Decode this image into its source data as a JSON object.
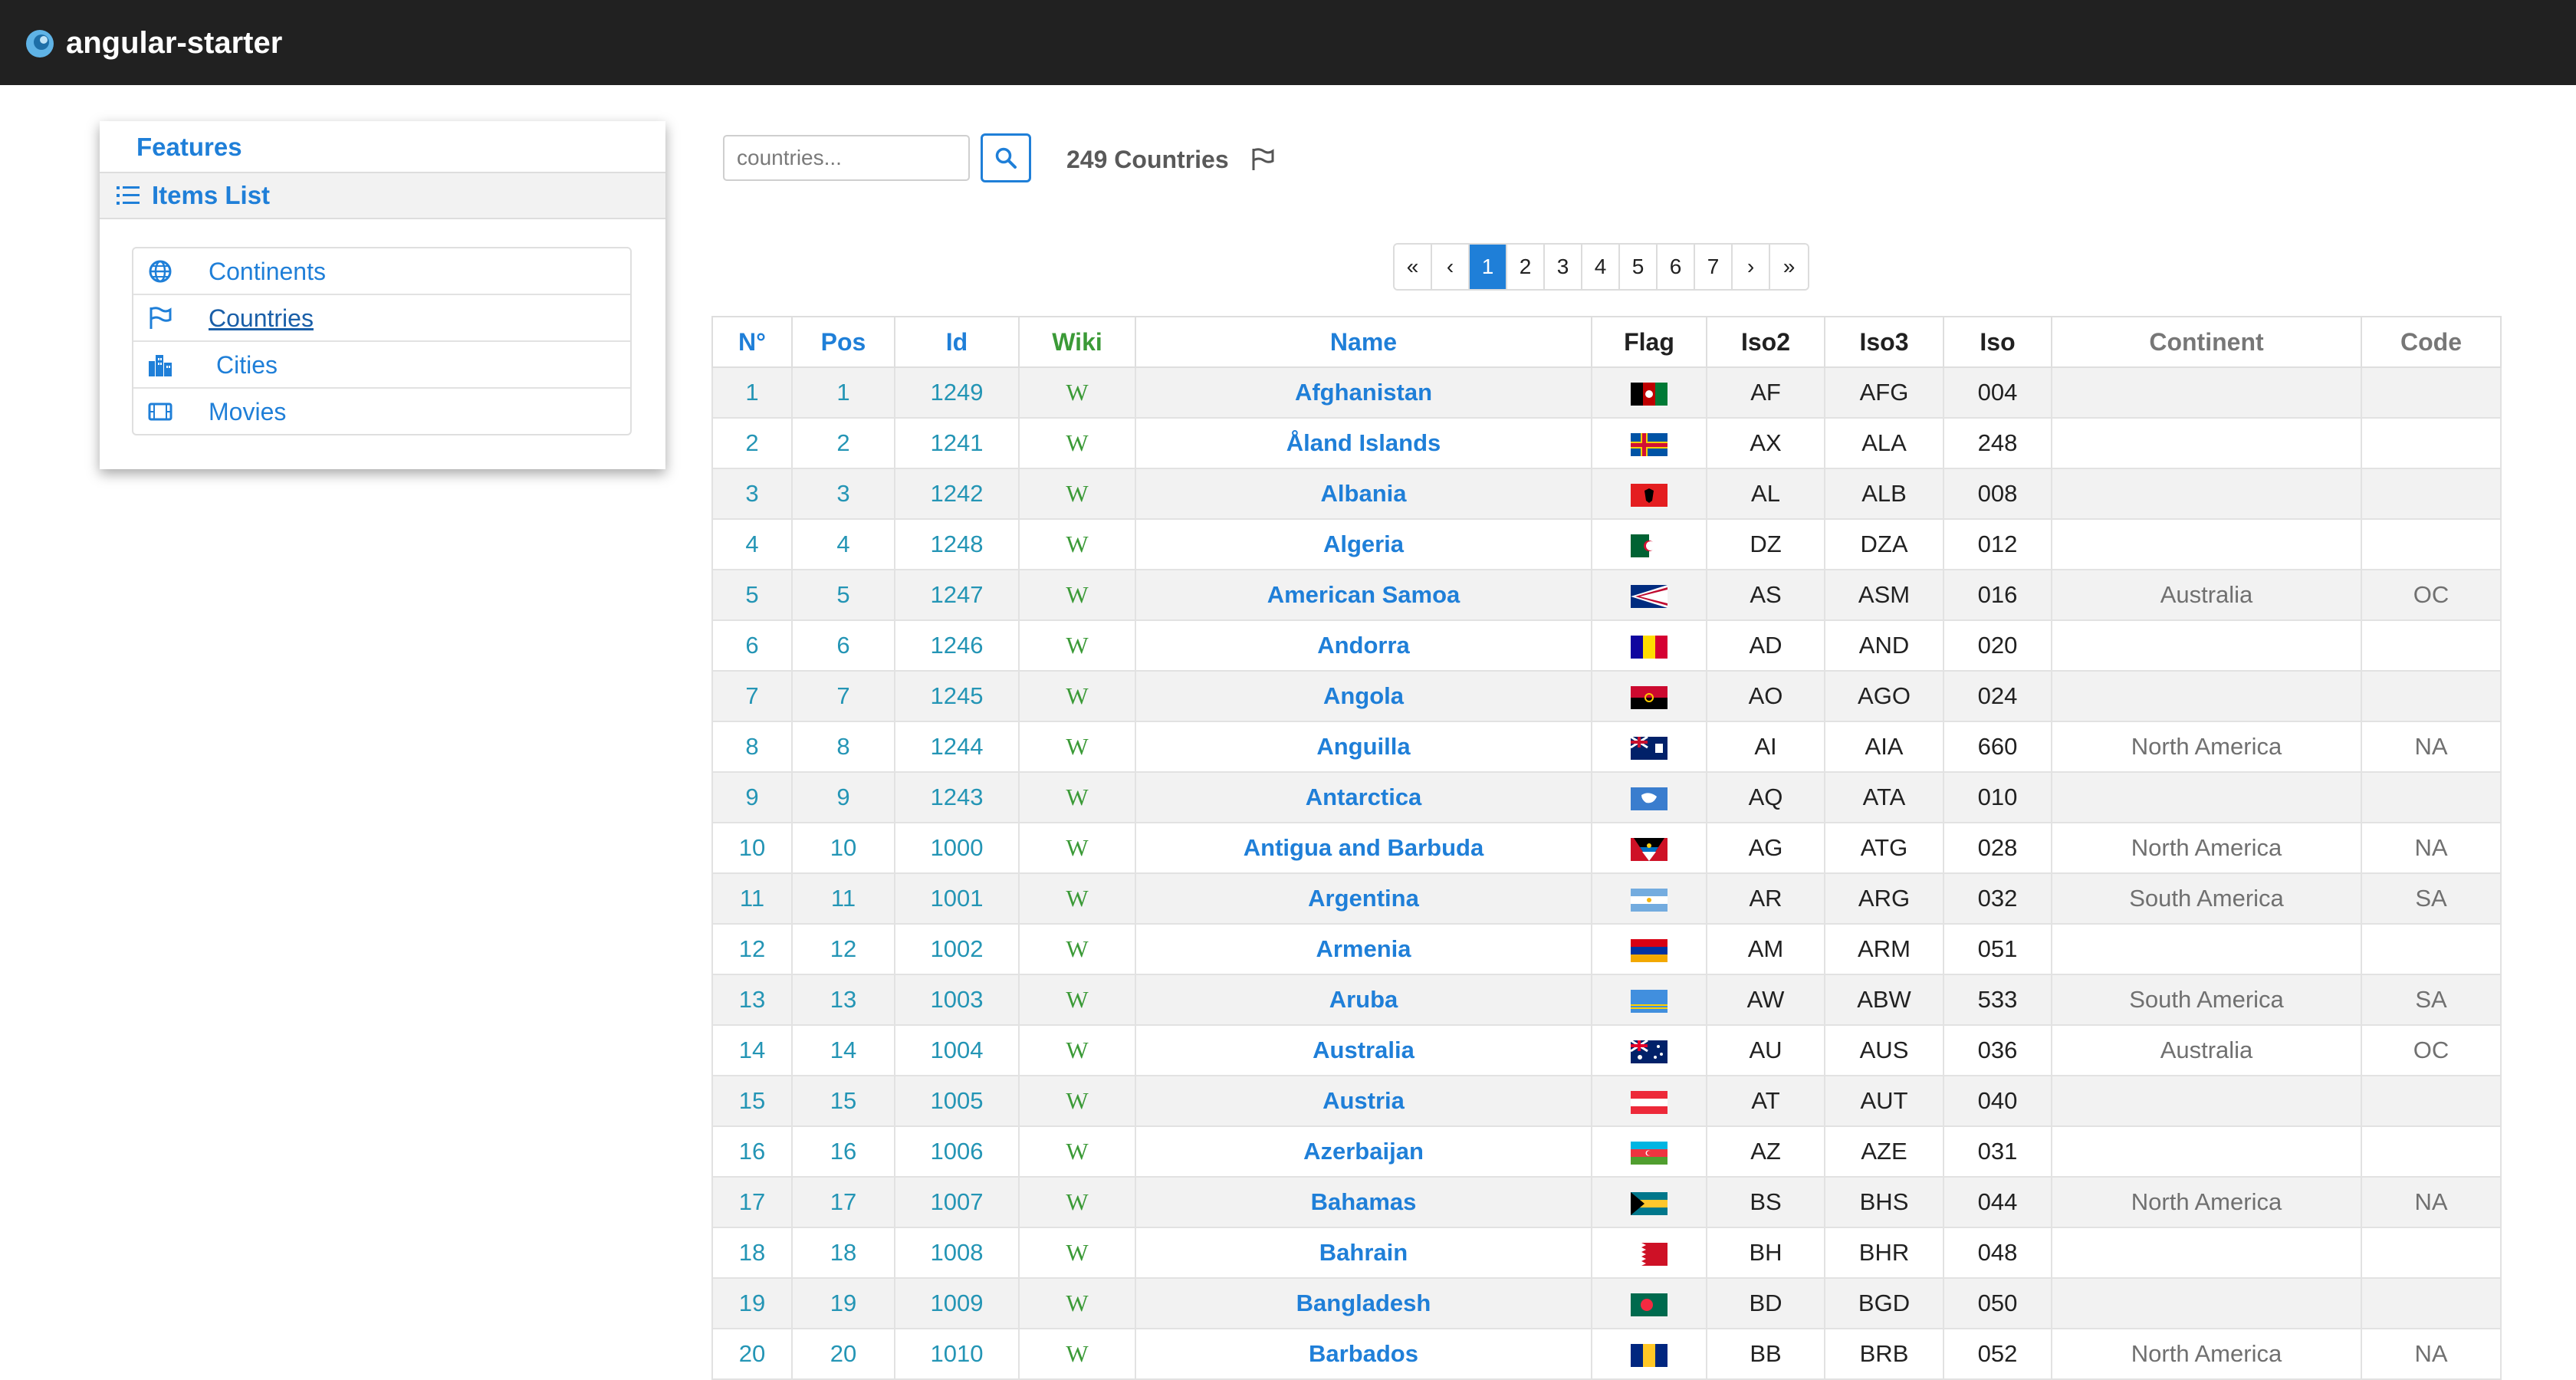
{
  "navbar": {
    "brand": "angular-starter"
  },
  "sidebar": {
    "features_title": "Features",
    "items_list_label": "Items List",
    "items": [
      {
        "label": "Continents",
        "icon": "globe-icon"
      },
      {
        "label": "Countries",
        "icon": "flag-icon"
      },
      {
        "label": "Cities",
        "icon": "city-icon"
      },
      {
        "label": "Movies",
        "icon": "film-icon"
      }
    ]
  },
  "search": {
    "placeholder": "countries...",
    "value": ""
  },
  "countries_count": "249 Countries",
  "pagination": [
    "«",
    "‹",
    "1",
    "2",
    "3",
    "4",
    "5",
    "6",
    "7",
    "›",
    "»"
  ],
  "pagination_active": "1",
  "colors": {
    "accent": "#1f7fd8",
    "teal": "#2495b5",
    "wiki_green": "#3b9a37",
    "navbar": "#212121"
  },
  "table": {
    "columns": [
      "N°",
      "Pos",
      "Id",
      "Wiki",
      "Name",
      "Flag",
      "Iso2",
      "Iso3",
      "Iso",
      "Continent",
      "Code"
    ],
    "wiki_glyph": "W",
    "rows": [
      {
        "n": "1",
        "pos": "1",
        "id": "1249",
        "name": "Afghanistan",
        "iso2": "AF",
        "iso3": "AFG",
        "iso": "004",
        "continent": "",
        "code": ""
      },
      {
        "n": "2",
        "pos": "2",
        "id": "1241",
        "name": "Åland Islands",
        "iso2": "AX",
        "iso3": "ALA",
        "iso": "248",
        "continent": "",
        "code": ""
      },
      {
        "n": "3",
        "pos": "3",
        "id": "1242",
        "name": "Albania",
        "iso2": "AL",
        "iso3": "ALB",
        "iso": "008",
        "continent": "",
        "code": ""
      },
      {
        "n": "4",
        "pos": "4",
        "id": "1248",
        "name": "Algeria",
        "iso2": "DZ",
        "iso3": "DZA",
        "iso": "012",
        "continent": "",
        "code": ""
      },
      {
        "n": "5",
        "pos": "5",
        "id": "1247",
        "name": "American Samoa",
        "iso2": "AS",
        "iso3": "ASM",
        "iso": "016",
        "continent": "Australia",
        "code": "OC"
      },
      {
        "n": "6",
        "pos": "6",
        "id": "1246",
        "name": "Andorra",
        "iso2": "AD",
        "iso3": "AND",
        "iso": "020",
        "continent": "",
        "code": ""
      },
      {
        "n": "7",
        "pos": "7",
        "id": "1245",
        "name": "Angola",
        "iso2": "AO",
        "iso3": "AGO",
        "iso": "024",
        "continent": "",
        "code": ""
      },
      {
        "n": "8",
        "pos": "8",
        "id": "1244",
        "name": "Anguilla",
        "iso2": "AI",
        "iso3": "AIA",
        "iso": "660",
        "continent": "North America",
        "code": "NA"
      },
      {
        "n": "9",
        "pos": "9",
        "id": "1243",
        "name": "Antarctica",
        "iso2": "AQ",
        "iso3": "ATA",
        "iso": "010",
        "continent": "",
        "code": ""
      },
      {
        "n": "10",
        "pos": "10",
        "id": "1000",
        "name": "Antigua and Barbuda",
        "iso2": "AG",
        "iso3": "ATG",
        "iso": "028",
        "continent": "North America",
        "code": "NA"
      },
      {
        "n": "11",
        "pos": "11",
        "id": "1001",
        "name": "Argentina",
        "iso2": "AR",
        "iso3": "ARG",
        "iso": "032",
        "continent": "South America",
        "code": "SA"
      },
      {
        "n": "12",
        "pos": "12",
        "id": "1002",
        "name": "Armenia",
        "iso2": "AM",
        "iso3": "ARM",
        "iso": "051",
        "continent": "",
        "code": ""
      },
      {
        "n": "13",
        "pos": "13",
        "id": "1003",
        "name": "Aruba",
        "iso2": "AW",
        "iso3": "ABW",
        "iso": "533",
        "continent": "South America",
        "code": "SA"
      },
      {
        "n": "14",
        "pos": "14",
        "id": "1004",
        "name": "Australia",
        "iso2": "AU",
        "iso3": "AUS",
        "iso": "036",
        "continent": "Australia",
        "code": "OC"
      },
      {
        "n": "15",
        "pos": "15",
        "id": "1005",
        "name": "Austria",
        "iso2": "AT",
        "iso3": "AUT",
        "iso": "040",
        "continent": "",
        "code": ""
      },
      {
        "n": "16",
        "pos": "16",
        "id": "1006",
        "name": "Azerbaijan",
        "iso2": "AZ",
        "iso3": "AZE",
        "iso": "031",
        "continent": "",
        "code": ""
      },
      {
        "n": "17",
        "pos": "17",
        "id": "1007",
        "name": "Bahamas",
        "iso2": "BS",
        "iso3": "BHS",
        "iso": "044",
        "continent": "North America",
        "code": "NA"
      },
      {
        "n": "18",
        "pos": "18",
        "id": "1008",
        "name": "Bahrain",
        "iso2": "BH",
        "iso3": "BHR",
        "iso": "048",
        "continent": "",
        "code": ""
      },
      {
        "n": "19",
        "pos": "19",
        "id": "1009",
        "name": "Bangladesh",
        "iso2": "BD",
        "iso3": "BGD",
        "iso": "050",
        "continent": "",
        "code": ""
      },
      {
        "n": "20",
        "pos": "20",
        "id": "1010",
        "name": "Barbados",
        "iso2": "BB",
        "iso3": "BRB",
        "iso": "052",
        "continent": "North America",
        "code": "NA"
      }
    ]
  }
}
